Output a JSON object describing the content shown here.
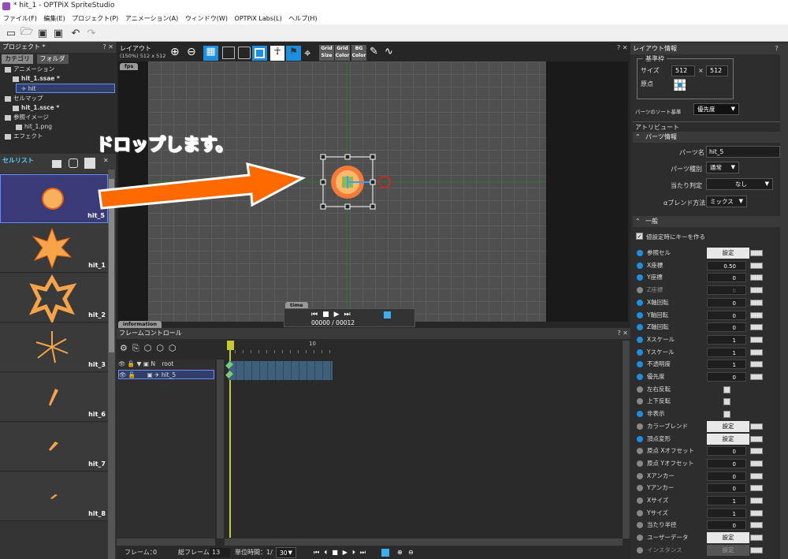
{
  "window": {
    "title": "* hit_1 - OPTPiX SpriteStudio"
  },
  "menu": [
    "ファイル(F)",
    "編集(E)",
    "プロジェクト(P)",
    "アニメーション(A)",
    "ウィンドウ(W)",
    "OPTPiX Labs(L)",
    "ヘルプ(H)"
  ],
  "project": {
    "title": "プロジェクト *",
    "tabs": [
      "カテゴリ",
      "フォルダ"
    ],
    "tree": [
      "アニメーション",
      "hit_1.ssae *",
      "hit",
      "セルマップ",
      "hit_1.ssce *",
      "参照イメージ",
      "hit_1.png",
      "エフェクト"
    ]
  },
  "cells": {
    "title": "セルリスト",
    "items": [
      "hit_5",
      "hit_1",
      "hit_2",
      "hit_3",
      "hit_6",
      "hit_7",
      "hit_8"
    ]
  },
  "layout": {
    "title": "レイアウト",
    "zoom": "(150%) 512 x 512",
    "tags": {
      "fps": "fps",
      "time": "time",
      "information": "information"
    },
    "grid_buttons": [
      {
        "a": "Grid",
        "b": "Size"
      },
      {
        "a": "Grid",
        "b": "Color"
      },
      {
        "a": "BG",
        "b": "Color"
      }
    ],
    "time_current": "00000",
    "time_sep": "/",
    "time_total": "00012"
  },
  "annotation": "ドロップします。",
  "frame": {
    "title": "フレームコントロール",
    "ruler_label": "10",
    "tracks": [
      {
        "name": "root",
        "prefix": "N"
      },
      {
        "name": "hit_5",
        "prefix": ""
      }
    ],
    "footer": {
      "frame_label": "フレーム：",
      "frame_value": "0",
      "total_label": "総フレーム：",
      "total_value": "13",
      "unit_label": "単位時間：1/",
      "unit_value": "30"
    }
  },
  "attr": {
    "title": "レイアウト情報",
    "base_group": "基準枠",
    "size_label": "サイズ",
    "size_w": "512",
    "size_x": "×",
    "size_h": "512",
    "origin_label": "原点",
    "sort_label": "パーツのソート基準",
    "sort_value": "優先度",
    "attribute_title": "アトリビュート",
    "parts_info": "パーツ情報",
    "part_name_label": "パーツ名",
    "part_name_value": "hit_5",
    "part_type_label": "パーツ種別",
    "part_type_value": "通常",
    "hit_label": "当たり判定",
    "hit_value": "なし",
    "blend_label": "αブレンド方法",
    "blend_value": "ミックス",
    "general": "一般",
    "auto_key_label": "値設定時にキーを作る",
    "rows": [
      {
        "label": "参照セル",
        "type": "btn",
        "value": "設定",
        "dot": "b"
      },
      {
        "label": "X座標",
        "type": "num",
        "value": "0.50",
        "dot": "b"
      },
      {
        "label": "Y座標",
        "type": "num",
        "value": "0",
        "dot": "b"
      },
      {
        "label": "Z座標",
        "type": "num",
        "value": "0",
        "dot": "g",
        "dim": true
      },
      {
        "label": "X軸回転",
        "type": "num",
        "value": "0",
        "dot": "b"
      },
      {
        "label": "Y軸回転",
        "type": "num",
        "value": "0",
        "dot": "b"
      },
      {
        "label": "Z軸回転",
        "type": "num",
        "value": "0",
        "dot": "b"
      },
      {
        "label": "Xスケール",
        "type": "num",
        "value": "1",
        "dot": "b"
      },
      {
        "label": "Yスケール",
        "type": "num",
        "value": "1",
        "dot": "b"
      },
      {
        "label": "不透明度",
        "type": "num",
        "value": "1",
        "dot": "b"
      },
      {
        "label": "優先度",
        "type": "num",
        "value": "0",
        "dot": "b"
      },
      {
        "label": "左右反転",
        "type": "chk",
        "value": "",
        "dot": "g"
      },
      {
        "label": "上下反転",
        "type": "chk",
        "value": "",
        "dot": "g"
      },
      {
        "label": "非表示",
        "type": "chk",
        "value": "",
        "dot": "b"
      },
      {
        "label": "カラーブレンド",
        "type": "btn",
        "value": "設定",
        "dot": "g"
      },
      {
        "label": "頂点変形",
        "type": "btn",
        "value": "設定",
        "dot": "b"
      },
      {
        "label": "原点 Xオフセット",
        "type": "num",
        "value": "0",
        "dot": "g"
      },
      {
        "label": "原点 Yオフセット",
        "type": "num",
        "value": "0",
        "dot": "g"
      },
      {
        "label": "Xアンカー",
        "type": "num",
        "value": "0",
        "dot": "g"
      },
      {
        "label": "Yアンカー",
        "type": "num",
        "value": "0",
        "dot": "g"
      },
      {
        "label": "Xサイズ",
        "type": "num",
        "value": "1",
        "dot": "g"
      },
      {
        "label": "Yサイズ",
        "type": "num",
        "value": "1",
        "dot": "g"
      },
      {
        "label": "当たり半径",
        "type": "num",
        "value": "0",
        "dot": "g"
      },
      {
        "label": "ユーザーデータ",
        "type": "btn",
        "value": "設定",
        "dot": "g"
      },
      {
        "label": "インスタンス",
        "type": "btn",
        "value": "設定",
        "dot": "g",
        "dim": true
      }
    ]
  },
  "colors": {
    "accent": "#1d8fe0",
    "arrow": "#ff6a00",
    "selection": "#3c3b7a",
    "keyframe": "#c8c830"
  }
}
